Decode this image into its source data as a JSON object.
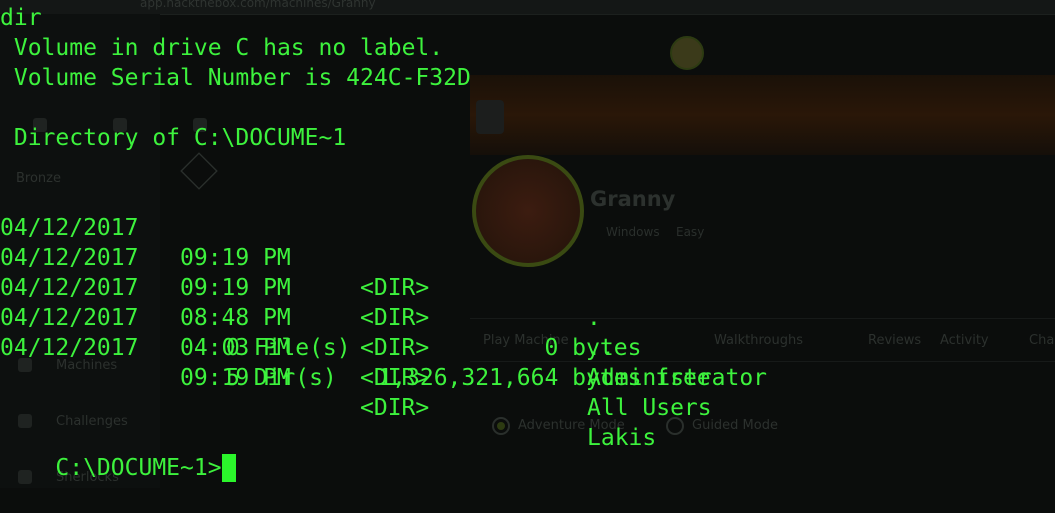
{
  "background": {
    "url_text": "app.hackthebox.com/machines/Granny",
    "sidebar": {
      "rank": "Bronze",
      "items": [
        "Machines",
        "Challenges",
        "Sherlocks"
      ]
    },
    "machine": {
      "name": "Granny",
      "os": "Windows",
      "difficulty": "Easy"
    },
    "tabs": [
      "Play Machine",
      "Walkthroughs",
      "Reviews",
      "Activity",
      "Cha"
    ],
    "modes": [
      "Adventure Mode",
      "Guided Mode"
    ]
  },
  "terminal": {
    "command": "dir",
    "volume_label_line": " Volume in drive C has no label.",
    "serial_line": " Volume Serial Number is 424C-F32D",
    "directory_line": " Directory of C:\\DOCUME~1",
    "entries": [
      {
        "date": "04/12/2017",
        "time": "09:19 PM",
        "type": "<DIR>",
        "name": "."
      },
      {
        "date": "04/12/2017",
        "time": "09:19 PM",
        "type": "<DIR>",
        "name": ".."
      },
      {
        "date": "04/12/2017",
        "time": "08:48 PM",
        "type": "<DIR>",
        "name": "Administrator"
      },
      {
        "date": "04/12/2017",
        "time": "04:03 PM",
        "type": "<DIR>",
        "name": "All Users"
      },
      {
        "date": "04/12/2017",
        "time": "09:19 PM",
        "type": "<DIR>",
        "name": "Lakis"
      }
    ],
    "files_summary": "0 File(s)              0 bytes",
    "dirs_summary": "5 Dir(s)   1,326,321,664 bytes free",
    "prompt": "C:\\DOCUME~1>",
    "colors": {
      "text": "#3df23d",
      "cursor": "#2bf52b",
      "background": "#0b0d0c"
    }
  }
}
